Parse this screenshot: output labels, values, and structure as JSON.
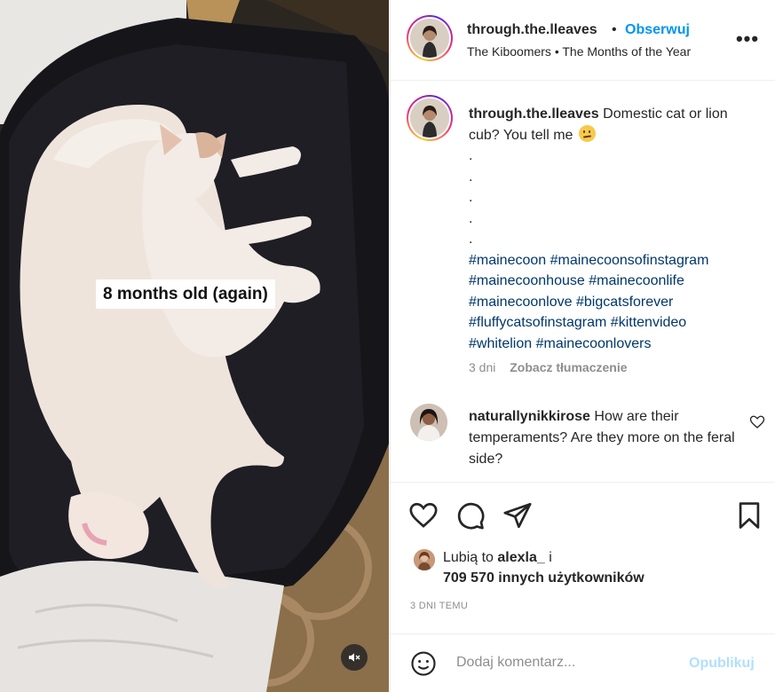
{
  "media": {
    "overlay_label": "8 months old (again)",
    "mute_icon": "speaker-muted-icon"
  },
  "header": {
    "username": "through.the.lleaves",
    "separator": "•",
    "follow_label": "Obserwuj",
    "audio": "The Kiboomers • The Months of the Year",
    "more_label": "•••",
    "follow_color": "#0095f6"
  },
  "caption": {
    "username": "through.the.lleaves",
    "text": "Domestic cat or lion cub? You tell me",
    "emoji": "confused-face",
    "dots": [
      ".",
      ".",
      ".",
      ".",
      "."
    ],
    "hashtags": [
      "#mainecoon",
      "#mainecoonsofinstagram",
      "#mainecoonhouse",
      "#mainecoonlife",
      "#mainecoonlove",
      "#bigcatsforever",
      "#fluffycatsofinstagram",
      "#kittenvideo",
      "#whitelion",
      "#mainecoonlovers"
    ],
    "age": "3 dni",
    "translate_label": "Zobacz tłumaczenie"
  },
  "comment": {
    "username": "naturallynikkirose",
    "text": "How are their temperaments? Are they more on the feral side?"
  },
  "actions": {
    "icons": [
      "heart-icon",
      "comment-icon",
      "share-icon",
      "bookmark-icon"
    ]
  },
  "likes": {
    "prefix": "Lubią to",
    "user": "alexla_",
    "conj": "i",
    "count_text": "709 570 innych użytkowników"
  },
  "timestamp": "3 DNI TEMU",
  "add_comment": {
    "placeholder": "Dodaj komentarz...",
    "publish_label": "Opublikuj",
    "publish_color": "#b2dffc"
  }
}
